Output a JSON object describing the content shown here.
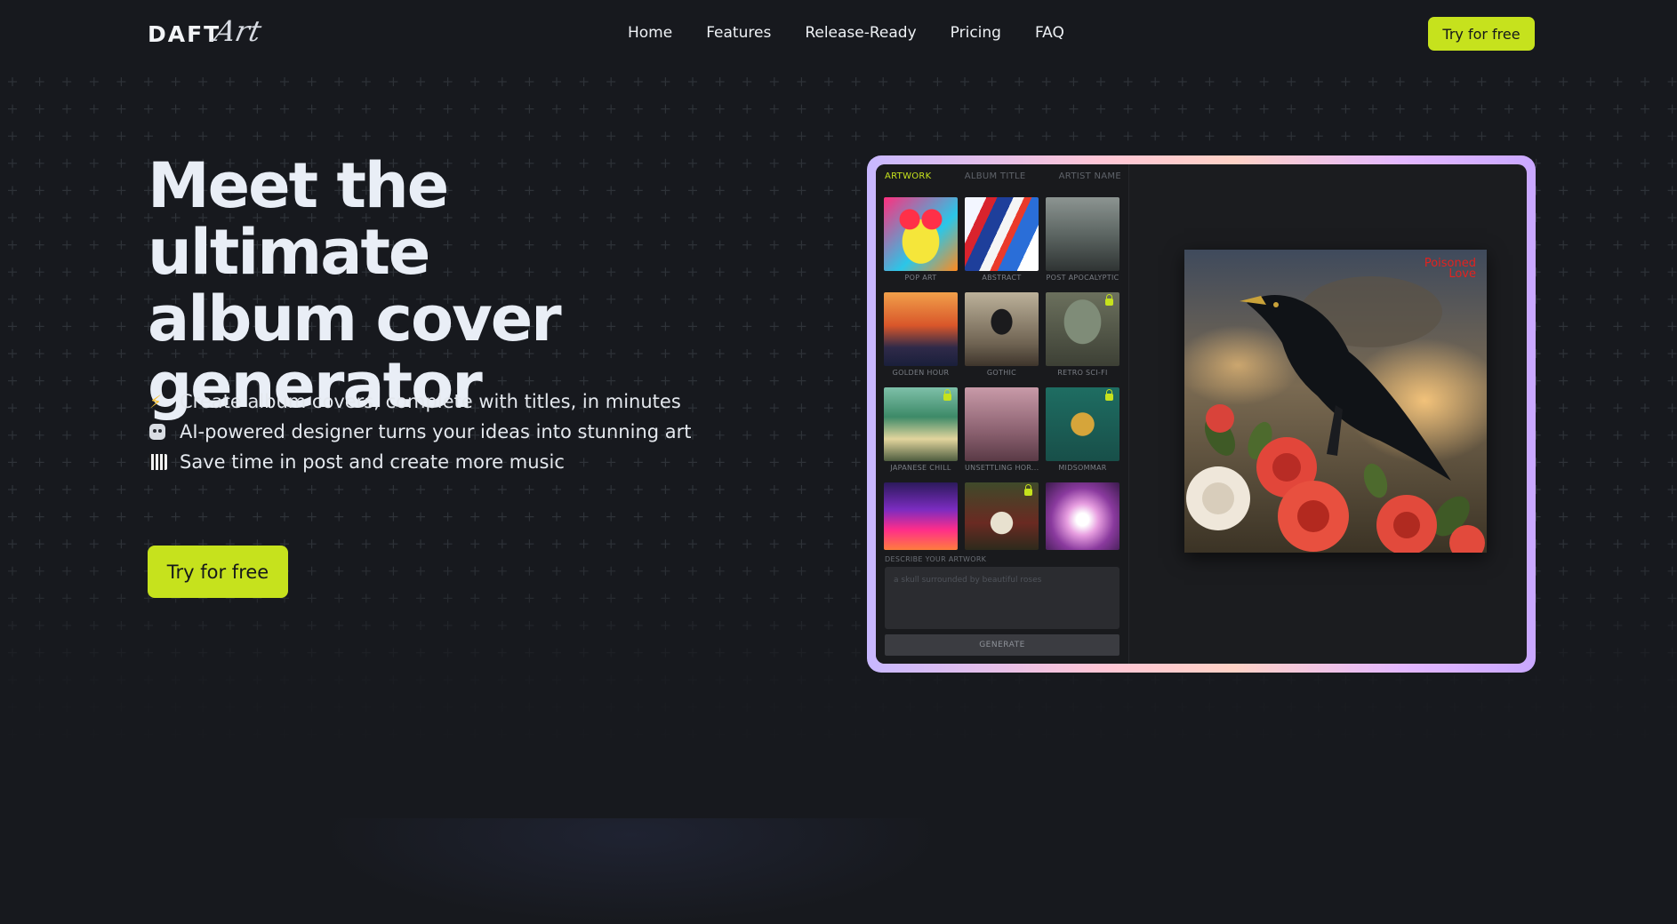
{
  "brand": {
    "logo_main": "DAFT",
    "logo_script": "Art"
  },
  "nav": {
    "links": [
      "Home",
      "Features",
      "Release-Ready",
      "Pricing",
      "FAQ"
    ],
    "cta": "Try for free"
  },
  "hero": {
    "title_lines": [
      "Meet the ultimate",
      "album cover",
      "generator"
    ],
    "bullets": [
      {
        "icon": "lightning-icon",
        "text": "Create album covers, complete with titles, in minutes"
      },
      {
        "icon": "robot-icon",
        "text": "AI-powered designer turns your ideas into stunning art"
      },
      {
        "icon": "piano-icon",
        "text": "Save time in post and create more music"
      }
    ],
    "cta": "Try for free"
  },
  "app": {
    "tabs": [
      "ARTWORK",
      "ALBUM TITLE",
      "ARTIST NAME"
    ],
    "active_tab": "ARTWORK",
    "styles": [
      {
        "label": "POP ART",
        "locked": false
      },
      {
        "label": "ABSTRACT",
        "locked": false
      },
      {
        "label": "POST APOCALYPTIC",
        "locked": false
      },
      {
        "label": "GOLDEN HOUR",
        "locked": false
      },
      {
        "label": "GOTHIC",
        "locked": false
      },
      {
        "label": "RETRO SCI-FI",
        "locked": true
      },
      {
        "label": "JAPANESE CHILL",
        "locked": true
      },
      {
        "label": "UNSETTLING HOR...",
        "locked": false
      },
      {
        "label": "MIDSOMMAR",
        "locked": true
      },
      {
        "label": "",
        "locked": false
      },
      {
        "label": "",
        "locked": true
      },
      {
        "label": "",
        "locked": false
      }
    ],
    "describe_label": "DESCRIBE YOUR ARTWORK",
    "describe_placeholder": "a skull surrounded by beautiful roses",
    "generate_label": "GENERATE",
    "cover_title_lines": [
      "Poisoned",
      "Love"
    ]
  },
  "colors": {
    "accent": "#c6e21d",
    "background": "#17191e",
    "cover_title": "#e3221f"
  }
}
